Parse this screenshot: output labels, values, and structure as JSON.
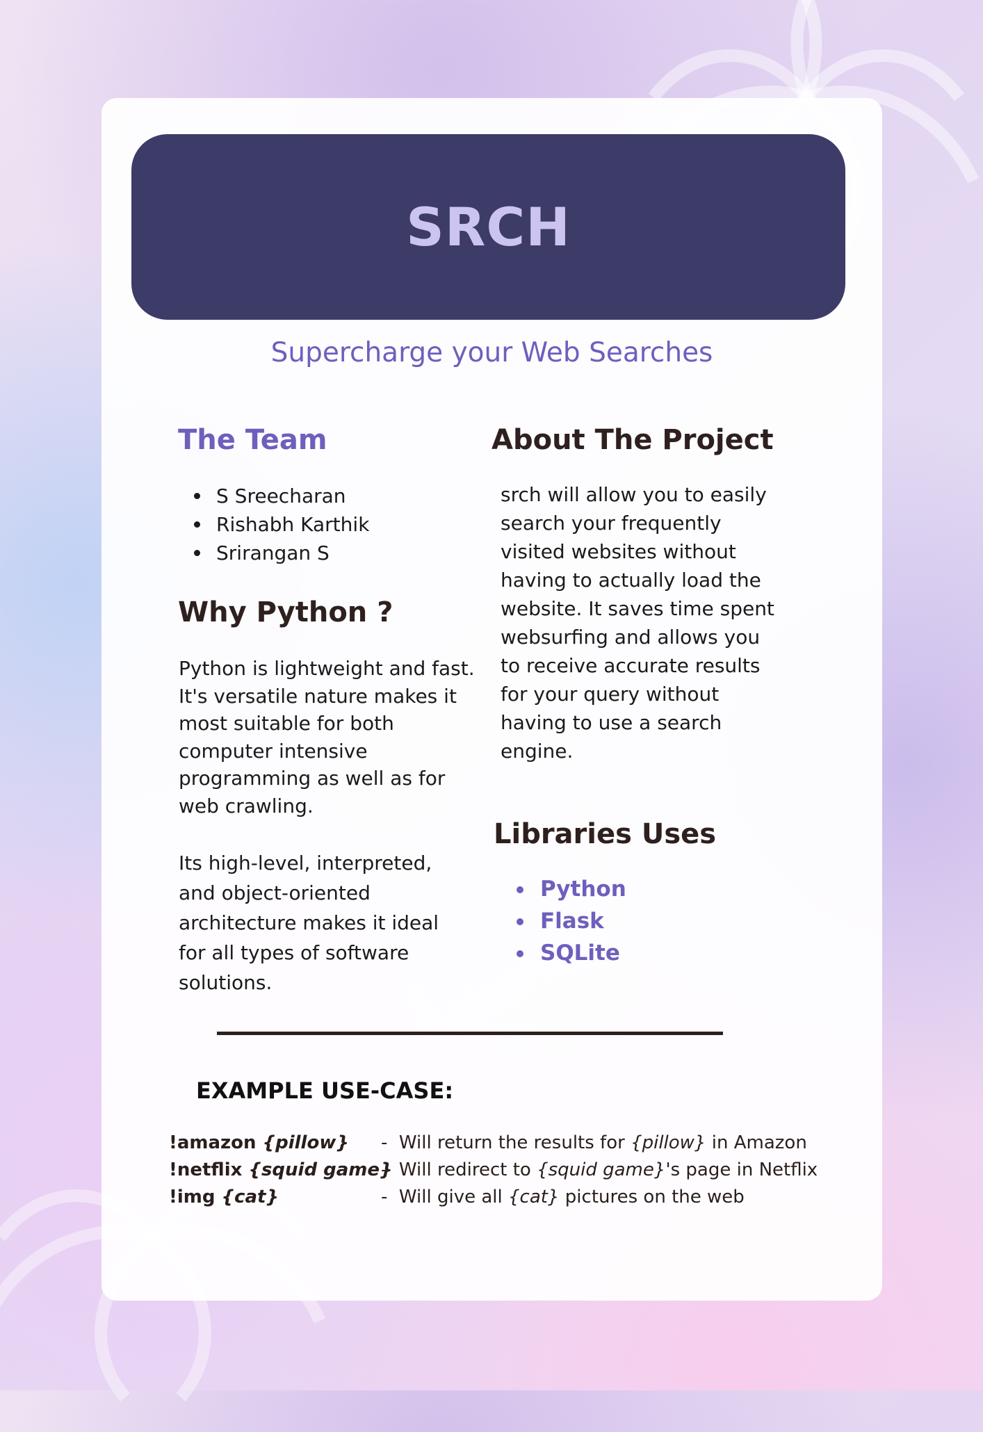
{
  "title": "SRCH",
  "tagline": "Supercharge your Web Searches",
  "team": {
    "heading": "The Team",
    "members": [
      "S Sreecharan",
      "Rishabh Karthik",
      "Srirangan S"
    ]
  },
  "why_python": {
    "heading": "Why Python ?",
    "paragraph1_lines": [
      "Python is lightweight and fast.",
      "It's versatile nature makes it",
      "most suitable for both",
      "computer intensive",
      "programming as well as for",
      "web crawling."
    ],
    "paragraph2_lines": [
      "Its high-level, interpreted,",
      "and object-oriented",
      "architecture makes it ideal",
      "for all types of software",
      "solutions."
    ]
  },
  "about": {
    "heading": "About The Project",
    "lines": [
      "srch will allow you to easily",
      "search your frequently",
      "visited websites without",
      "having to actually load the",
      "website. It saves time spent",
      "websurfing and allows you",
      "to receive accurate results",
      "for your query without",
      "having to use a search",
      "engine."
    ]
  },
  "libraries": {
    "heading": "Libraries Uses",
    "items": [
      "Python",
      "Flask",
      "SQLite"
    ]
  },
  "examples": {
    "heading": "EXAMPLE USE-CASE:",
    "rows": [
      {
        "cmd": "!amazon ",
        "cmd_arg": "{pillow}",
        "desc_prefix": "-  Will return the results for ",
        "desc_arg": "{pillow}",
        "desc_suffix": " in Amazon"
      },
      {
        "cmd": "!netflix ",
        "cmd_arg": "{squid game}",
        "desc_prefix": "-  Will redirect to ",
        "desc_arg": "{squid game}",
        "desc_suffix": "'s page in Netflix"
      },
      {
        "cmd": "!img ",
        "cmd_arg": "{cat}",
        "desc_prefix": "-  Will give all ",
        "desc_arg": "{cat}",
        "desc_suffix": " pictures on the web"
      }
    ]
  },
  "colors": {
    "banner": "#3d3b68",
    "banner_text": "#cbc3f0",
    "accent": "#6e5fbd",
    "heading": "#2e201e"
  }
}
